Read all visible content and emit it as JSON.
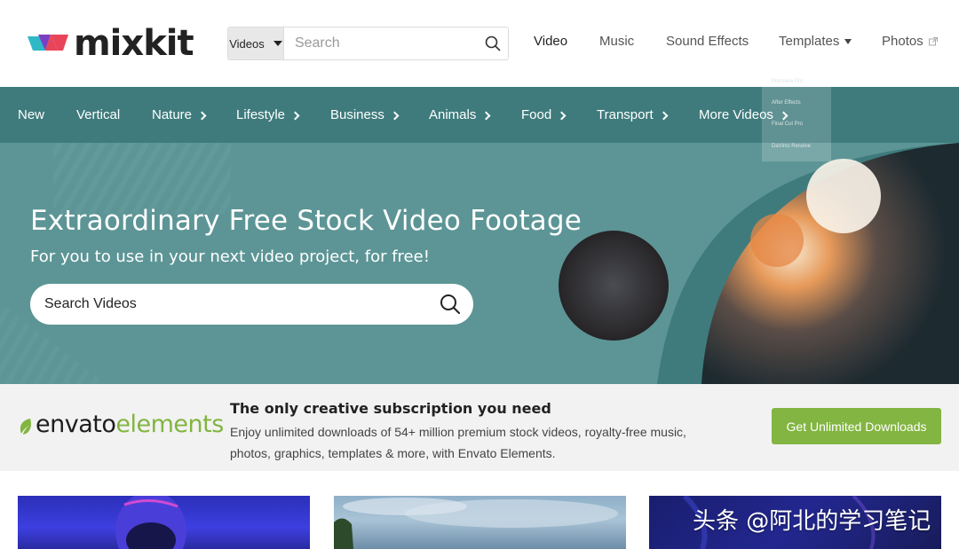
{
  "logo": {
    "text": "mixkit"
  },
  "search": {
    "category": "Videos",
    "placeholder": "Search"
  },
  "topnav": [
    {
      "label": "Video"
    },
    {
      "label": "Music"
    },
    {
      "label": "Sound Effects"
    },
    {
      "label": "Templates"
    },
    {
      "label": "Photos"
    }
  ],
  "categories": [
    {
      "label": "New"
    },
    {
      "label": "Vertical"
    },
    {
      "label": "Nature"
    },
    {
      "label": "Lifestyle"
    },
    {
      "label": "Business"
    },
    {
      "label": "Animals"
    },
    {
      "label": "Food"
    },
    {
      "label": "Transport"
    },
    {
      "label": "More Videos"
    }
  ],
  "templates_dropdown": [
    "Premiere Pro",
    "After Effects",
    "Final Cut Pro",
    "DaVinci Resolve"
  ],
  "hero": {
    "title": "Extraordinary Free Stock Video Footage",
    "subtitle": "For you to use in your next video project, for free!",
    "search_placeholder": "Search Videos"
  },
  "envato": {
    "logo_part1": "envato",
    "logo_part2": "elements",
    "heading": "The only creative subscription you need",
    "body": "Enjoy unlimited downloads of 54+ million premium stock videos, royalty-free music, photos, graphics, templates & more, with Envato Elements.",
    "button": "Get Unlimited Downloads"
  },
  "watermark": "头条 @阿北的学习笔记",
  "colors": {
    "teal_bar": "#3f7b7c",
    "hero_bg": "#5d9596",
    "envato_green": "#82b541"
  }
}
